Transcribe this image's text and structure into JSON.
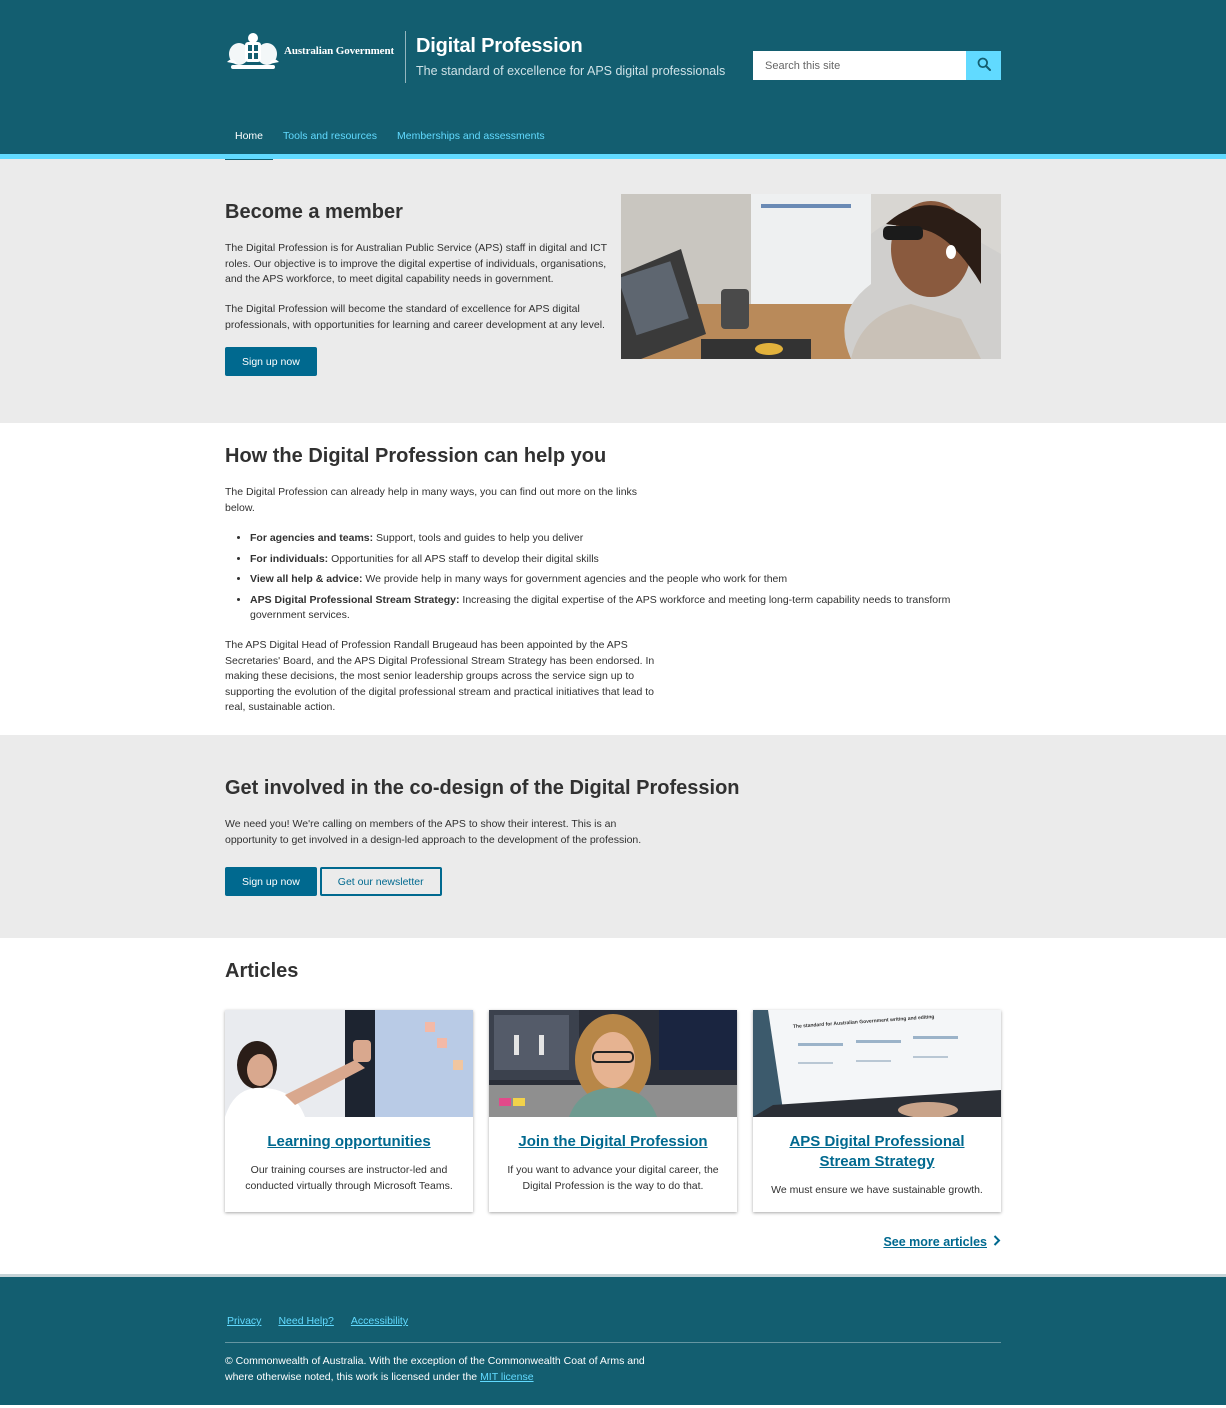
{
  "header": {
    "gov_name": "Australian Government",
    "site_name": "Digital Profession",
    "tagline": "The standard of excellence for APS digital professionals",
    "search_placeholder": "Search this site"
  },
  "nav": {
    "items": [
      {
        "label": "Home",
        "active": true
      },
      {
        "label": "Tools and resources",
        "active": false
      },
      {
        "label": "Memberships and assessments",
        "active": false
      }
    ]
  },
  "hero": {
    "title": "Become a member",
    "para1": "The Digital Profession is for Australian Public Service (APS) staff in digital and ICT roles. Our objective is to improve the digital expertise of individuals, organisations, and the APS workforce, to meet digital capability needs in government.",
    "para2": "The Digital Profession will become the standard of excellence for APS digital professionals, with opportunities for learning and career development at any level.",
    "button": "Sign up now"
  },
  "help": {
    "title": "How the Digital Profession can help you",
    "intro": "The Digital Profession can already help in many ways, you can find out more on the links below.",
    "items": [
      {
        "bold": "For agencies and teams:",
        "text": " Support, tools and guides to help you deliver"
      },
      {
        "bold": "For individuals:",
        "text": " Opportunities for all APS staff to develop their digital skills"
      },
      {
        "bold": "View all help & advice:",
        "text": " We provide help in many ways for government agencies and the people who work for them"
      },
      {
        "bold": "APS Digital Professional Stream Strategy:",
        "text": " Increasing the digital expertise of the APS workforce and meeting long-term capability needs to transform government services."
      }
    ],
    "closing": "The APS Digital Head of Profession Randall Brugeaud has been appointed by the APS Secretaries' Board, and the APS Digital Professional Stream Strategy has been endorsed. In making these decisions, the most senior leadership groups across the service sign up to supporting the evolution of the digital professional stream and practical initiatives that lead to real, sustainable action."
  },
  "codesign": {
    "title": "Get involved in the co-design of the Digital Profession",
    "para": "We need you! We're calling on members of the APS to show their interest. This is an opportunity to get involved in a design-led approach to the development of the profession.",
    "primary_button": "Sign up now",
    "secondary_button": "Get our newsletter"
  },
  "articles": {
    "title": "Articles",
    "cards": [
      {
        "title": "Learning opportunities",
        "text": "Our training courses are instructor-led and conducted virtually through Microsoft Teams."
      },
      {
        "title": "Join the Digital Profession",
        "text": "If you want to advance your digital career, the Digital Profession is the way to do that."
      },
      {
        "title": "APS Digital Professional Stream Strategy",
        "text": "We must ensure we have sustainable growth."
      }
    ],
    "card3_image_text": "The standard for Australian Government writing and editing",
    "see_more": "See more articles"
  },
  "footer": {
    "links": [
      "Privacy",
      "Need Help?",
      "Accessibility"
    ],
    "copyright": "© Commonwealth of Australia. With the exception of the Commonwealth Coat of Arms and where otherwise noted, this work is licensed under the ",
    "license_link": "MIT license"
  },
  "colors": {
    "header_bg": "#135e70",
    "accent": "#61daff",
    "primary_button": "#00698f",
    "section_grey": "#ebebeb"
  }
}
